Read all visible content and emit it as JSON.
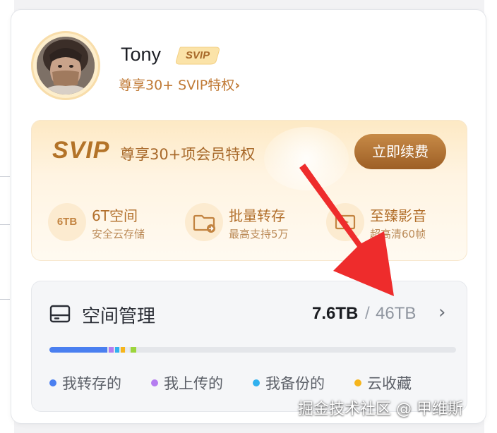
{
  "profile": {
    "username": "Tony",
    "badge": "SVIP",
    "privilege_link": "尊享30+ SVIP特权",
    "privilege_chevron": "›"
  },
  "svip_panel": {
    "logo": "SVIP",
    "slogan": "尊享30+项会员特权",
    "renew_button": "立即续费",
    "features": [
      {
        "icon": "6TB",
        "icon_name": "storage-6tb-icon",
        "title": "6T空间",
        "subtitle": "安全云存储"
      },
      {
        "icon": "",
        "icon_name": "folder-transfer-icon",
        "title": "批量转存",
        "subtitle": "最高支持5万"
      },
      {
        "icon": "",
        "icon_name": "video-icon",
        "title": "至臻影音",
        "subtitle": "超高清60帧"
      }
    ]
  },
  "space": {
    "title": "空间管理",
    "used": "7.6TB",
    "separator": "/",
    "total": "46TB",
    "chevron": "›",
    "usage_fraction": 0.17,
    "legend": [
      {
        "label": "我转存的",
        "color": "#4a7ff0"
      },
      {
        "label": "我上传的",
        "color": "#b47cf0"
      },
      {
        "label": "我备份的",
        "color": "#31b1ef"
      },
      {
        "label": "云收藏",
        "color": "#f6b51c"
      }
    ]
  },
  "colors": {
    "accent": "#b26f2b",
    "arrow": "#ee2c2c"
  },
  "watermark": "掘金技术社区 @ 甲维斯"
}
